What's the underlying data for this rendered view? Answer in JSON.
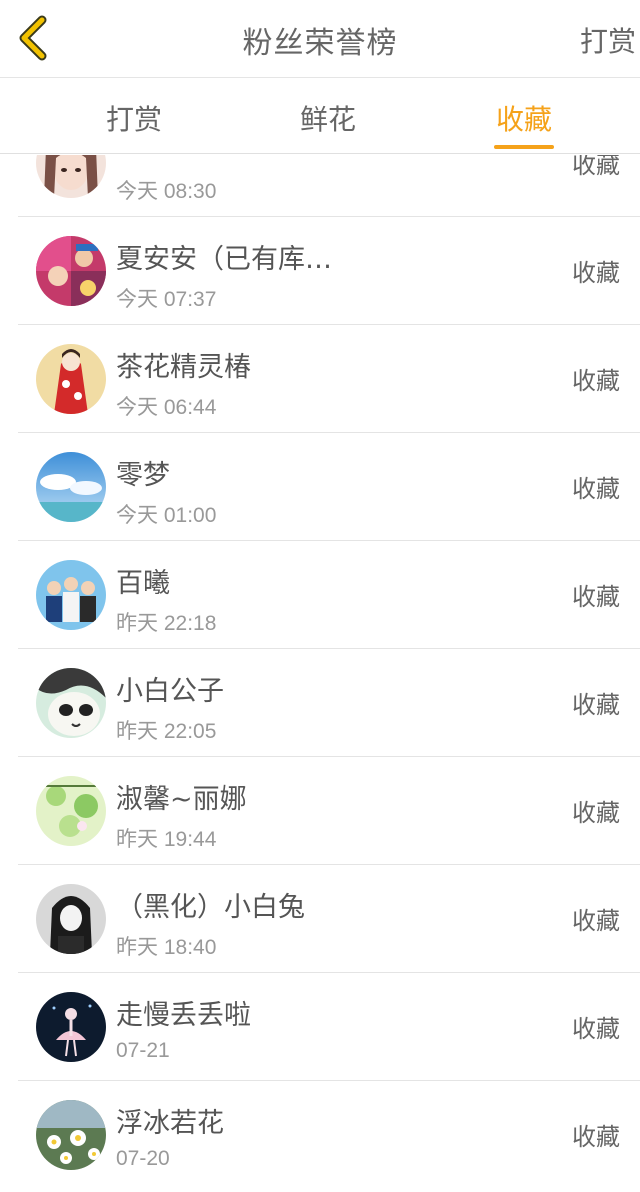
{
  "header": {
    "title": "粉丝荣誉榜",
    "right_label": "打赏"
  },
  "tabs": [
    {
      "label": "打赏",
      "active": false
    },
    {
      "label": "鲜花",
      "active": false
    },
    {
      "label": "收藏",
      "active": true
    }
  ],
  "colors": {
    "accent": "#f5a21a",
    "text": "#666666",
    "muted": "#999999"
  },
  "rows": [
    {
      "name": "",
      "time": "今天 08:30",
      "action": "收藏",
      "avatar": "girl-avatar"
    },
    {
      "name": "夏安安（已有库…",
      "time": "今天 07:37",
      "action": "收藏",
      "avatar": "anime-collage-avatar"
    },
    {
      "name": "茶花精灵椿",
      "time": "今天 06:44",
      "action": "收藏",
      "avatar": "red-kimono-avatar"
    },
    {
      "name": "零梦",
      "time": "今天 01:00",
      "action": "收藏",
      "avatar": "sky-sea-avatar"
    },
    {
      "name": "百曦",
      "time": "昨天 22:18",
      "action": "收藏",
      "avatar": "three-boys-avatar"
    },
    {
      "name": "小白公子",
      "time": "昨天 22:05",
      "action": "收藏",
      "avatar": "cartoon-face-avatar"
    },
    {
      "name": "淑馨~丽娜",
      "time": "昨天 19:44",
      "action": "收藏",
      "avatar": "green-floral-avatar"
    },
    {
      "name": "（黑化）小白兔",
      "time": "昨天 18:40",
      "action": "收藏",
      "avatar": "dark-hair-girl-avatar"
    },
    {
      "name": "走慢丢丢啦",
      "time": "07-21",
      "action": "收藏",
      "avatar": "ballerina-avatar"
    },
    {
      "name": "浮冰若花",
      "time": "07-20",
      "action": "收藏",
      "avatar": "daisies-avatar"
    }
  ]
}
